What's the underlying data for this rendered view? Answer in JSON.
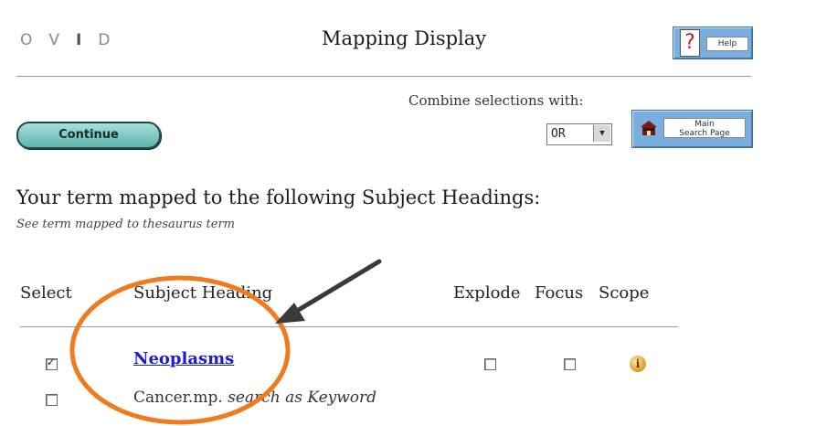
{
  "header": {
    "logo": [
      "O",
      "V",
      "I",
      "D"
    ],
    "title": "Mapping Display",
    "help_label": "Help",
    "help_symbol": "?"
  },
  "toolbar": {
    "continue_label": "Continue",
    "combine_label": "Combine selections with:",
    "combine_value": "OR",
    "main_search_label_line1": "Main",
    "main_search_label_line2": "Search Page"
  },
  "main": {
    "heading": "Your term mapped to the following Subject Headings:",
    "subheading": "See term mapped to thesaurus term",
    "columns": {
      "select": "Select",
      "subject": "Subject Heading",
      "explode": "Explode",
      "focus": "Focus",
      "scope": "Scope"
    },
    "rows": [
      {
        "selected": true,
        "subject": "Neoplasms",
        "explode": false,
        "focus": false,
        "scope_icon": "info-icon"
      },
      {
        "selected": false,
        "term": "Cancer.mp.",
        "action": "search as Keyword"
      }
    ]
  },
  "colors": {
    "button_blue": "#7aaede",
    "continue_teal": "#5fb2ae",
    "link_blue": "#1a1ad8",
    "annotation_orange": "#f07a1e",
    "annotation_arrow": "#3a3a3a"
  }
}
